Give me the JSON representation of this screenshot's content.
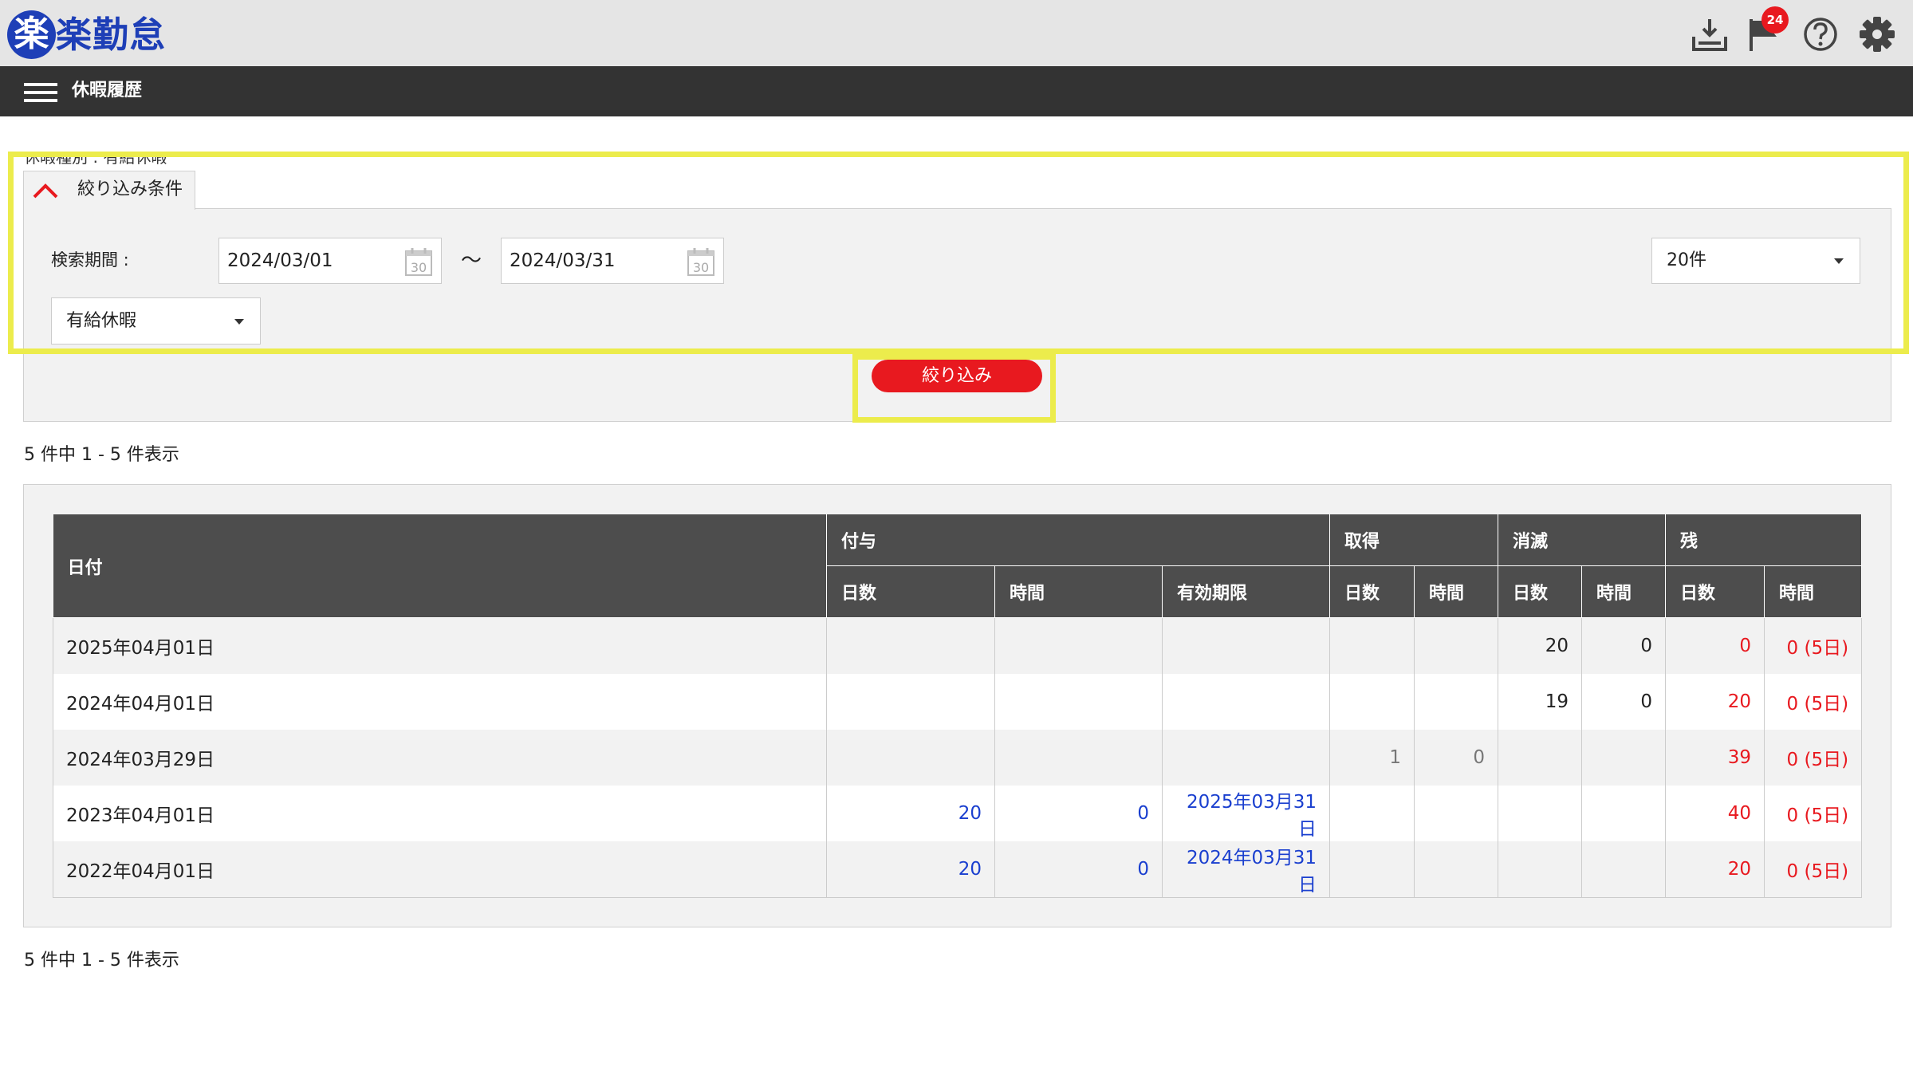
{
  "app": {
    "logo_mark": "楽",
    "logo_text": "楽勤怠",
    "notification_count": "24"
  },
  "nav": {
    "title": "休暇履歴"
  },
  "filter": {
    "cut_text": "休暇種別 : 有給休暇",
    "tab_label": "絞り込み条件",
    "period_label": "検索期間 :",
    "date_from": "2024/03/01",
    "date_to": "2024/03/31",
    "tilde": "～",
    "calendar_day": "30",
    "count_option": "20件",
    "type_option": "有給休暇",
    "apply_label": "絞り込み"
  },
  "summary": {
    "count_text": "5 件中 1 - 5 件表示"
  },
  "table": {
    "header_top": [
      "日付",
      "付与",
      "取得",
      "消滅",
      "残"
    ],
    "header_sub": [
      "日数",
      "時間",
      "有効期限",
      "日数",
      "時間",
      "日数",
      "時間",
      "日数",
      "時間"
    ],
    "rows": [
      {
        "date": "2025年04月01日",
        "g_days": "",
        "g_time": "",
        "g_exp": "",
        "t_days": "",
        "t_time": "",
        "e_days": "20",
        "e_time": "0",
        "r_days": "0",
        "r_time": "0 (5日)"
      },
      {
        "date": "2024年04月01日",
        "g_days": "",
        "g_time": "",
        "g_exp": "",
        "t_days": "",
        "t_time": "",
        "e_days": "19",
        "e_time": "0",
        "r_days": "20",
        "r_time": "0 (5日)"
      },
      {
        "date": "2024年03月29日",
        "g_days": "",
        "g_time": "",
        "g_exp": "",
        "t_days": "1",
        "t_time": "0",
        "e_days": "",
        "e_time": "",
        "r_days": "39",
        "r_time": "0 (5日)"
      },
      {
        "date": "2023年04月01日",
        "g_days": "20",
        "g_time": "0",
        "g_exp": "2025年03月31日",
        "t_days": "",
        "t_time": "",
        "e_days": "",
        "e_time": "",
        "r_days": "40",
        "r_time": "0 (5日)"
      },
      {
        "date": "2022年04月01日",
        "g_days": "20",
        "g_time": "0",
        "g_exp": "2024年03月31日",
        "t_days": "",
        "t_time": "",
        "e_days": "",
        "e_time": "",
        "r_days": "20",
        "r_time": "0 (5日)"
      }
    ]
  },
  "colors": {
    "brand": "#1e3fb7",
    "accent": "#e8191f",
    "highlight": "#ecec4c",
    "link": "#1a3fcf"
  },
  "icons": [
    "inbox-download-icon",
    "flag-icon",
    "help-icon",
    "gear-icon",
    "hamburger-menu-icon",
    "chevron-up-icon",
    "calendar-icon",
    "caret-down-icon"
  ]
}
